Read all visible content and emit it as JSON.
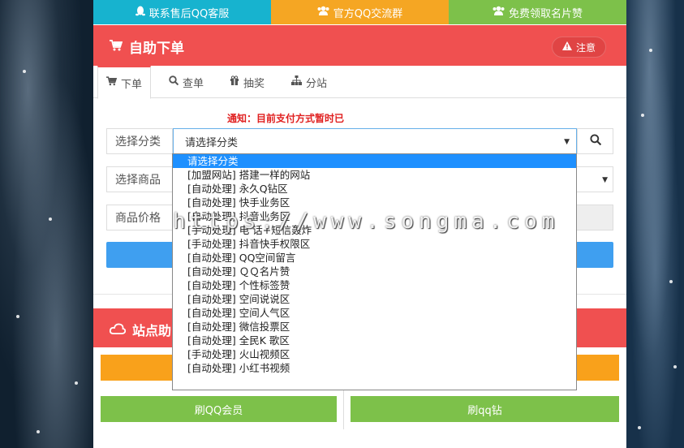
{
  "topbar": {
    "customer_service": "联系售后QQ客服",
    "official_group": "官方QQ交流群",
    "free_likes": "免费领取名片赞"
  },
  "order_panel": {
    "title": "自助下单",
    "notice_button": "注意"
  },
  "tabs": [
    {
      "label": "下单"
    },
    {
      "label": "查单"
    },
    {
      "label": "抽奖"
    },
    {
      "label": "分站"
    }
  ],
  "notification": "通知：目前支付方式暂时已",
  "form": {
    "category_label": "选择分类",
    "category_value": "请选择分类",
    "product_label": "选择商品",
    "price_label": "商品价格"
  },
  "dropdown": {
    "options": [
      "请选择分类",
      "[加盟网站] 搭建一样的网站",
      "[自动处理] 永久Q钻区",
      "[自动处理] 快手业务区",
      "[自动处理] 抖音业务区",
      "[手动处理] 电 话+短信轰炸",
      "[手动处理] 抖音快手权限区",
      "[自动处理] QQ空间留言",
      "[自动处理] ＱＱ名片赞",
      "[自动处理] 个性标签赞",
      "[自动处理] 空间说说区",
      "[自动处理] 空间人气区",
      "[自动处理] 微信投票区",
      "[自动处理] 全民K 歌区",
      "[手动处理] 火山视频区",
      "[自动处理] 小红书视频"
    ]
  },
  "site_panel": {
    "title": "站点助"
  },
  "buttons": {
    "qq_vip": "刷QQ会员",
    "qq_diamond": "刷qq钻"
  },
  "watermark": "https://www.songma.com",
  "colors": {
    "red": "#f05050",
    "cyan": "#17b3cf",
    "orange": "#f5a623",
    "green": "#7dc14a",
    "blue": "#3f9ff0"
  }
}
